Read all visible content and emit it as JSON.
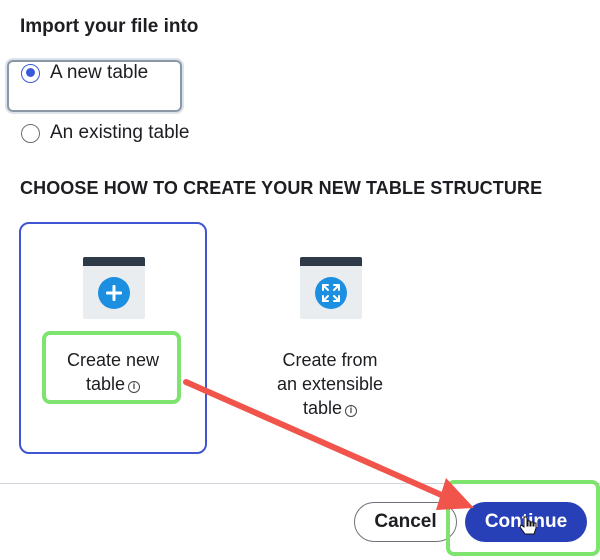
{
  "import": {
    "title": "Import your file into",
    "options": [
      {
        "label": "A new table",
        "selected": true
      },
      {
        "label": "An existing table",
        "selected": false
      }
    ]
  },
  "structure": {
    "title": "CHOOSE HOW TO CREATE YOUR NEW TABLE STRUCTURE",
    "cards": [
      {
        "line1": "Create new",
        "line2": "table",
        "icon": "plus-icon",
        "selected": true
      },
      {
        "line1": "Create from",
        "line2": "an extensible",
        "line3": "table",
        "icon": "expand-arrows-icon",
        "selected": false
      }
    ]
  },
  "footer": {
    "cancel_label": "Cancel",
    "continue_label": "Continue"
  },
  "colors": {
    "accent": "#3f55d2",
    "primary_button": "#2740b8",
    "icon_blue": "#1c8fe0",
    "highlight_green": "#7ee36f",
    "annotation_arrow": "#f0544b"
  }
}
